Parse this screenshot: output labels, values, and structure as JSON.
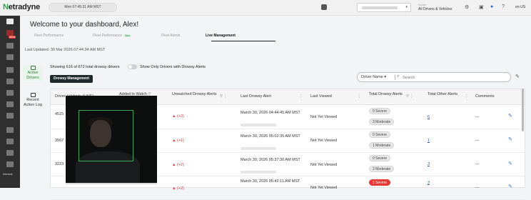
{
  "app": {
    "logo_n": "N",
    "logo_rest": "etradyne"
  },
  "topbar": {
    "clock": "Mon 07:45:31 AM MST",
    "scope_label": "Scope",
    "scope_value": "All Drivers & Vehicles",
    "user": "en-US",
    "icons": [
      "calendar-icon",
      "account-dropdown",
      "settings-icon",
      "grid-icon",
      "notification-icon",
      "help-icon",
      "user-icon"
    ]
  },
  "sidebar": {
    "internal_label": "Internal",
    "new_badge": "NEW"
  },
  "page": {
    "welcome": "Welcome to your dashboard, Alex!",
    "tabs": [
      {
        "label": "Fleet Performance"
      },
      {
        "label": "Fleet Performance",
        "badge": "New"
      },
      {
        "label": "Fleet Admin"
      },
      {
        "label": "Live Management"
      }
    ],
    "last_updated": "Last Updated: 30 Mar 2026 07:44:34 AM MST"
  },
  "left_menu": [
    {
      "label": "Active Drivers",
      "active": true
    },
    {
      "label": "Recent Action Log",
      "active": false
    }
  ],
  "controls": {
    "showing": "Showing 616 of 672 total drowsy drivers",
    "toggle_label": "Show Only Drivers with Drowsy Alerts",
    "toggle_on": false,
    "tab_label": "Drowsy Management",
    "search_field": "Driver Name",
    "search_placeholder": "Search"
  },
  "table": {
    "headers": {
      "driver": "Driver / Vehicle (LIVE)",
      "added": "Added to Watch",
      "unwatched": "Unwatched Drowsy Alerts",
      "last_alert": "Last Drowsy Alert",
      "last_viewed": "Last Viewed",
      "total_drowsy": "Total Drowsy Alerts",
      "total_other": "Total Other Alerts",
      "comments": "Comments"
    },
    "rows": [
      {
        "id": "4515",
        "unwatched": "(+3)",
        "alert": "March 30, 2026 04:44:45 AM MST",
        "viewed": "Not Yet Viewed",
        "severe": "0 Severe",
        "moderate": "3 Moderate",
        "other": "6",
        "comment": "---"
      },
      {
        "id": "3567",
        "unwatched": "(+1)",
        "alert": "March 30, 2026 05:02:35 AM MST",
        "viewed": "Not Yet Viewed",
        "severe": "0 Severe",
        "moderate": "1 Moderate",
        "other": "1",
        "comment": "---"
      },
      {
        "id": "3223",
        "unwatched": "(+2)",
        "alert": "March 30, 2026 05:37:30 AM MST",
        "viewed": "Not Yet Viewed",
        "severe": "0 Severe",
        "moderate": "2 Moderate",
        "other": "3",
        "comment": "---"
      },
      {
        "id": "",
        "unwatched": "(+2)",
        "alert": "March 30, 2026 05:42:11 AM MST",
        "viewed": "Not Yet Viewed",
        "severe": "1 Severe",
        "moderate": "",
        "other": "3",
        "comment": "---"
      }
    ]
  }
}
